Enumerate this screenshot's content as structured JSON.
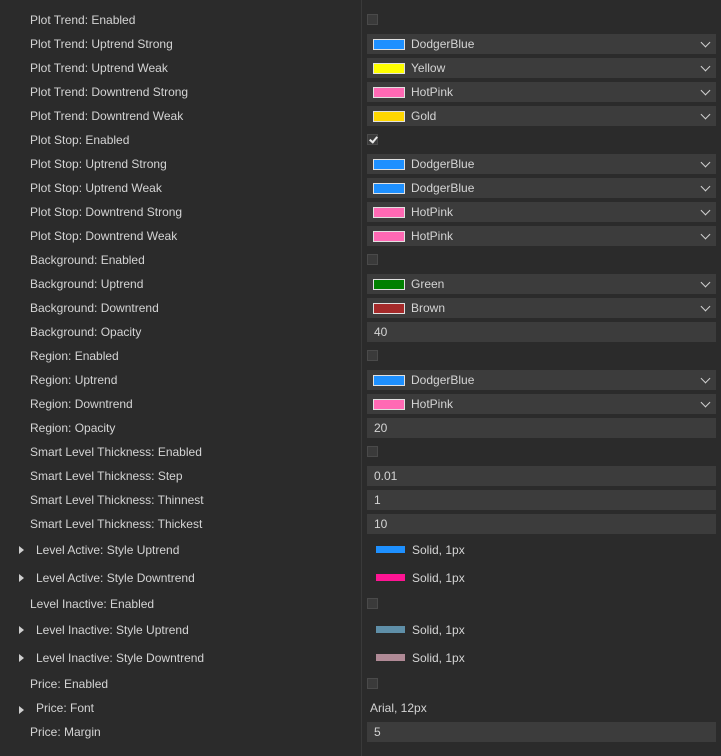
{
  "rows": [
    {
      "type": "checkbox",
      "label": "Plot Trend: Enabled",
      "checked": false
    },
    {
      "type": "color",
      "label": "Plot Trend: Uptrend Strong",
      "value": "DodgerBlue",
      "color": "#1e90ff"
    },
    {
      "type": "color",
      "label": "Plot Trend: Uptrend Weak",
      "value": "Yellow",
      "color": "#ffff00"
    },
    {
      "type": "color",
      "label": "Plot Trend: Downtrend Strong",
      "value": "HotPink",
      "color": "#ff69b4"
    },
    {
      "type": "color",
      "label": "Plot Trend: Downtrend Weak",
      "value": "Gold",
      "color": "#ffd700"
    },
    {
      "type": "checkbox",
      "label": "Plot Stop: Enabled",
      "checked": true
    },
    {
      "type": "color",
      "label": "Plot Stop: Uptrend Strong",
      "value": "DodgerBlue",
      "color": "#1e90ff"
    },
    {
      "type": "color",
      "label": "Plot Stop: Uptrend Weak",
      "value": "DodgerBlue",
      "color": "#1e90ff"
    },
    {
      "type": "color",
      "label": "Plot Stop: Downtrend Strong",
      "value": "HotPink",
      "color": "#ff69b4"
    },
    {
      "type": "color",
      "label": "Plot Stop: Downtrend Weak",
      "value": "HotPink",
      "color": "#ff69b4"
    },
    {
      "type": "checkbox",
      "label": "Background: Enabled",
      "checked": false
    },
    {
      "type": "color",
      "label": "Background: Uptrend",
      "value": "Green",
      "color": "#008000"
    },
    {
      "type": "color",
      "label": "Background: Downtrend",
      "value": "Brown",
      "color": "#a52a2a"
    },
    {
      "type": "input",
      "label": "Background: Opacity",
      "value": "40"
    },
    {
      "type": "checkbox",
      "label": "Region: Enabled",
      "checked": false
    },
    {
      "type": "color",
      "label": "Region: Uptrend",
      "value": "DodgerBlue",
      "color": "#1e90ff"
    },
    {
      "type": "color",
      "label": "Region: Downtrend",
      "value": "HotPink",
      "color": "#ff69b4"
    },
    {
      "type": "input",
      "label": "Region: Opacity",
      "value": "20"
    },
    {
      "type": "checkbox",
      "label": "Smart Level Thickness: Enabled",
      "checked": false
    },
    {
      "type": "input",
      "label": "Smart Level Thickness: Step",
      "value": "0.01"
    },
    {
      "type": "input",
      "label": "Smart Level Thickness: Thinnest",
      "value": "1"
    },
    {
      "type": "input",
      "label": "Smart Level Thickness: Thickest",
      "value": "10"
    },
    {
      "type": "stroke",
      "label": "Level Active: Style Uptrend",
      "value": "Solid, 1px",
      "color": "#1e90ff"
    },
    {
      "type": "stroke",
      "label": "Level Active: Style Downtrend",
      "value": "Solid, 1px",
      "color": "#ff1493"
    },
    {
      "type": "checkbox",
      "label": "Level Inactive: Enabled",
      "checked": false
    },
    {
      "type": "stroke",
      "label": "Level Inactive: Style Uptrend",
      "value": "Solid, 1px",
      "color": "#5f8fa8"
    },
    {
      "type": "stroke",
      "label": "Level Inactive: Style Downtrend",
      "value": "Solid, 1px",
      "color": "#b08a96"
    },
    {
      "type": "checkbox",
      "label": "Price: Enabled",
      "checked": false
    },
    {
      "type": "font",
      "label": "Price: Font",
      "value": "Arial, 12px"
    },
    {
      "type": "input",
      "label": "Price: Margin",
      "value": "5"
    }
  ]
}
